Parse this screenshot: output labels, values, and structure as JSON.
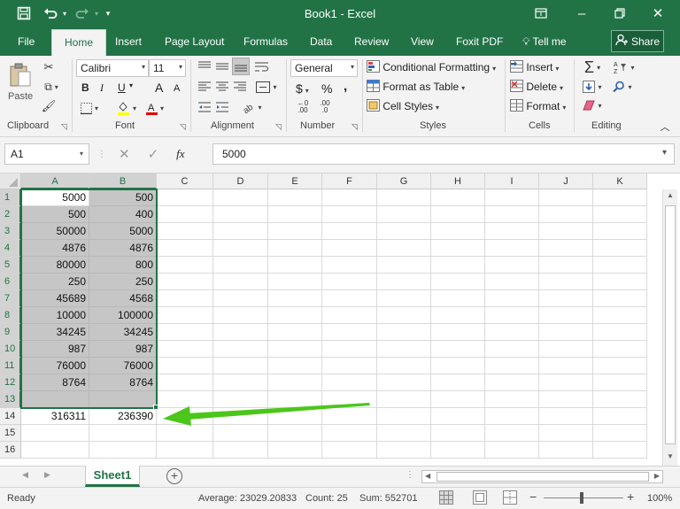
{
  "titlebar": {
    "title": "Book1  -  Excel"
  },
  "tabs": [
    "File",
    "Home",
    "Insert",
    "Page Layout",
    "Formulas",
    "Data",
    "Review",
    "View",
    "Foxit PDF"
  ],
  "tell_me": "Tell me",
  "share_label": "Share",
  "ribbon": {
    "clipboard": {
      "paste": "Paste",
      "label": "Clipboard"
    },
    "font": {
      "name": "Calibri",
      "size": "11",
      "label": "Font",
      "bold": "B",
      "italic": "I",
      "underline": "U",
      "grow": "A",
      "shrink": "A"
    },
    "alignment": {
      "label": "Alignment"
    },
    "number": {
      "format": "General",
      "currency": "$",
      "percent": "%",
      "comma": ",",
      "inc_dec": ".00",
      "dec_dec": ".0",
      "label": "Number"
    },
    "styles": {
      "conditional": "Conditional Formatting",
      "format_table": "Format as Table",
      "cell_styles": "Cell Styles",
      "label": "Styles"
    },
    "cells": {
      "insert": "Insert",
      "delete": "Delete",
      "format": "Format",
      "label": "Cells"
    },
    "editing": {
      "label": "Editing"
    }
  },
  "formula_bar": {
    "name_box": "A1",
    "fx": "fx",
    "value": "5000"
  },
  "columns": [
    "A",
    "B",
    "C",
    "D",
    "E",
    "F",
    "G",
    "H",
    "I",
    "J",
    "K"
  ],
  "rows": [
    {
      "num": "1",
      "a": "5000",
      "b": "500"
    },
    {
      "num": "2",
      "a": "500",
      "b": "400"
    },
    {
      "num": "3",
      "a": "50000",
      "b": "5000"
    },
    {
      "num": "4",
      "a": "4876",
      "b": "4876"
    },
    {
      "num": "5",
      "a": "80000",
      "b": "800"
    },
    {
      "num": "6",
      "a": "250",
      "b": "250"
    },
    {
      "num": "7",
      "a": "45689",
      "b": "4568"
    },
    {
      "num": "8",
      "a": "10000",
      "b": "100000"
    },
    {
      "num": "9",
      "a": "34245",
      "b": "34245"
    },
    {
      "num": "10",
      "a": "987",
      "b": "987"
    },
    {
      "num": "11",
      "a": "76000",
      "b": "76000"
    },
    {
      "num": "12",
      "a": "8764",
      "b": "8764"
    },
    {
      "num": "13",
      "a": "",
      "b": ""
    },
    {
      "num": "14",
      "a": "316311",
      "b": "236390"
    },
    {
      "num": "15",
      "a": "",
      "b": ""
    },
    {
      "num": "16",
      "a": "",
      "b": ""
    }
  ],
  "selection": {
    "rows": 13,
    "columns": 2
  },
  "sheet_tab": "Sheet1",
  "status": {
    "ready": "Ready",
    "average": "Average: 23029.20833",
    "count": "Count: 25",
    "sum": "Sum: 552701",
    "zoom": "100%"
  },
  "colors": {
    "excel_green": "#217346",
    "selection_fill": "#c6c6c6",
    "arrow": "#4cc61b"
  }
}
